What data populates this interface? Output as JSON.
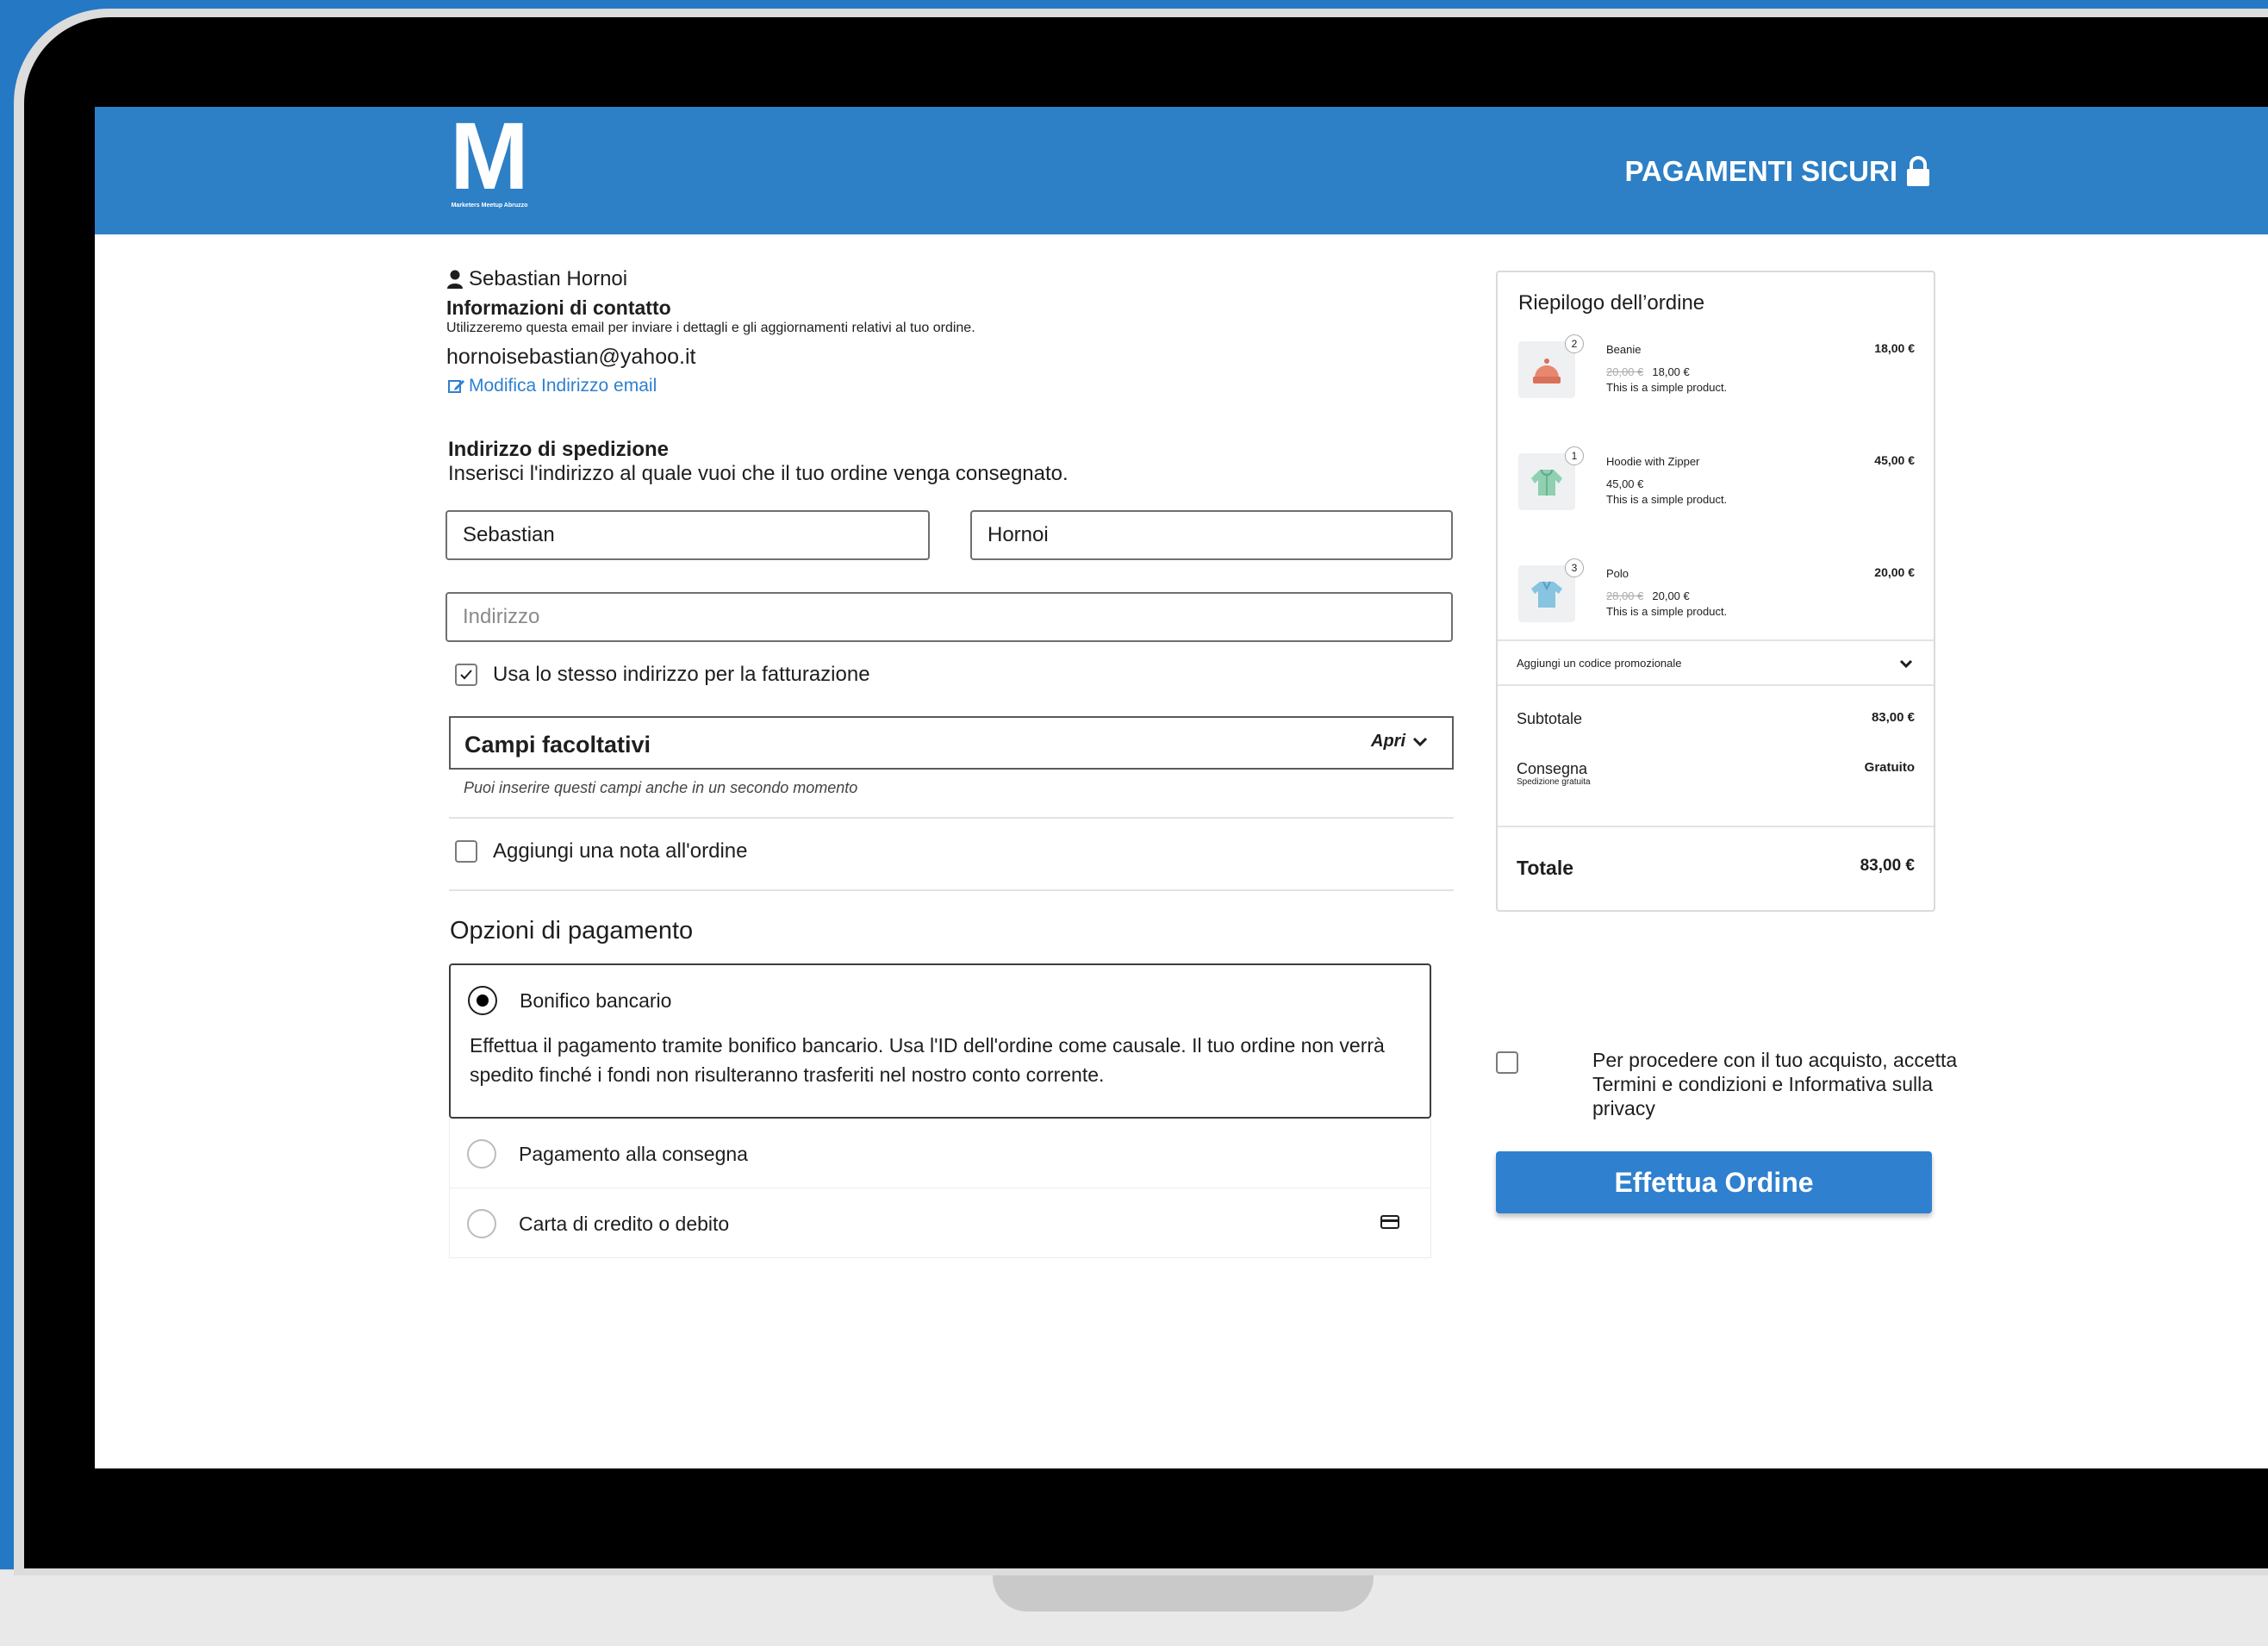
{
  "header": {
    "logo_letter": "M",
    "logo_subtitle": "Marketers Meetup Abruzzo",
    "secure_label": "PAGAMENTI SICURI"
  },
  "contact": {
    "user_name": "Sebastian Hornoi",
    "title": "Informazioni di contatto",
    "description": "Utilizzeremo questa email per inviare i dettagli e gli aggiornamenti relativi al tuo ordine.",
    "email": "hornoisebastian@yahoo.it",
    "edit_link": "Modifica Indirizzo email"
  },
  "shipping": {
    "title": "Indirizzo di spedizione",
    "description": "Inserisci l'indirizzo al quale vuoi che il tuo ordine venga consegnato.",
    "first_name": "Sebastian",
    "last_name": "Hornoi",
    "address_placeholder": "Indirizzo",
    "same_billing_label": "Usa lo stesso indirizzo per la fatturazione"
  },
  "optional_fields": {
    "title": "Campi facoltativi",
    "open_label": "Apri",
    "hint": "Puoi inserire questi campi anche in un secondo momento"
  },
  "order_note_label": "Aggiungi una nota all'ordine",
  "payment": {
    "title": "Opzioni di pagamento",
    "options": [
      {
        "label": "Bonifico bancario",
        "description": "Effettua il pagamento tramite bonifico bancario. Usa l'ID dell'ordine come causale. Il tuo ordine non verrà spedito finché i fondi non risulteranno trasferiti nel nostro conto corrente."
      },
      {
        "label": "Pagamento alla consegna"
      },
      {
        "label": "Carta di credito o debito"
      }
    ]
  },
  "summary": {
    "title": "Riepilogo dell’ordine",
    "items": [
      {
        "qty": "2",
        "name": "Beanie",
        "total": "18,00 €",
        "old_price": "20,00 €",
        "price": "18,00 €",
        "short": "This is a simple product.",
        "color": "#e8876f"
      },
      {
        "qty": "1",
        "name": "Hoodie with Zipper",
        "total": "45,00 €",
        "old_price": "",
        "price": "45,00 €",
        "short": "This is a simple product.",
        "color": "#8fd0b0"
      },
      {
        "qty": "3",
        "name": "Polo",
        "total": "20,00 €",
        "old_price": "28,00 €",
        "price": "20,00 €",
        "short": "This is a simple product.",
        "color": "#86c4e0"
      }
    ],
    "coupon_label": "Aggiungi un codice promozionale",
    "subtotal_label": "Subtotale",
    "subtotal_value": "83,00 €",
    "shipping_label": "Consegna",
    "shipping_sub": "Spedizione gratuita",
    "shipping_value": "Gratuito",
    "total_label": "Totale",
    "total_value": "83,00 €"
  },
  "terms_label": "Per procedere con il tuo acquisto, accetta Termini e condizioni e Informativa sulla privacy",
  "place_order_label": "Effettua Ordine"
}
